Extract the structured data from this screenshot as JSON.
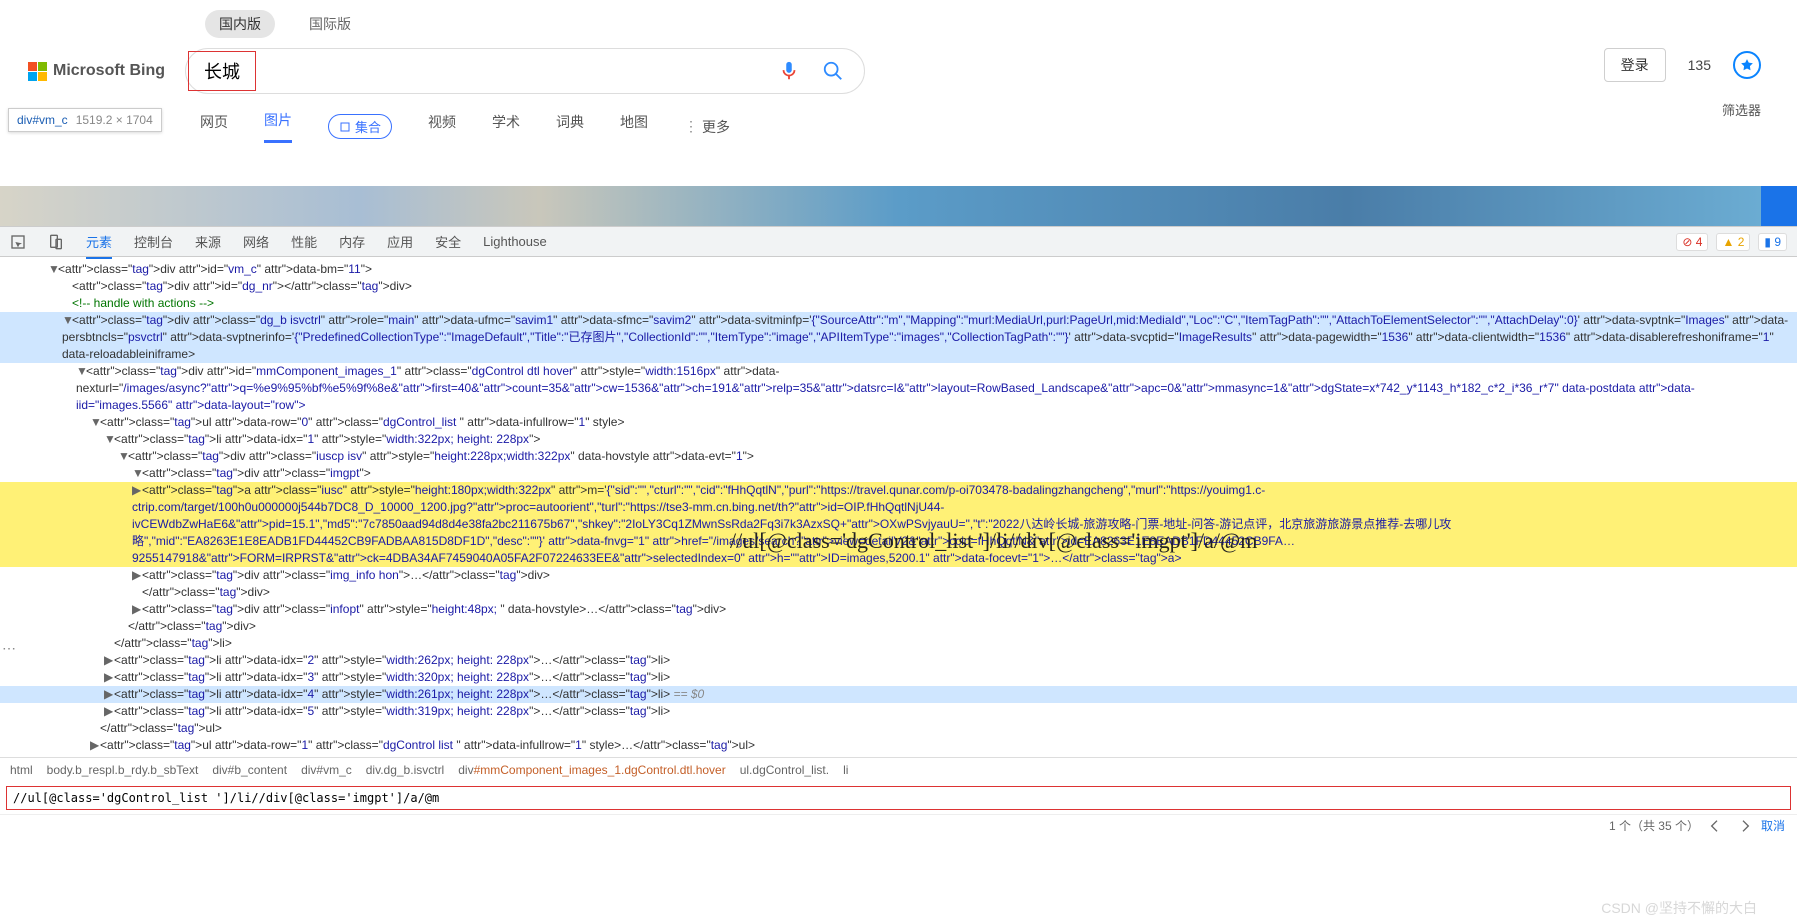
{
  "region_tabs": {
    "domestic": "国内版",
    "intl": "国际版"
  },
  "logo": "Microsoft Bing",
  "search": {
    "value": "长城"
  },
  "top_right": {
    "login": "登录",
    "number": "135"
  },
  "filter_label": "筛选器",
  "nav": {
    "web": "网页",
    "images": "图片",
    "collect": "集合",
    "video": "视频",
    "scholar": "学术",
    "dict": "词典",
    "map": "地图",
    "more": "更多"
  },
  "tooltip": {
    "selector": "div#vm_c",
    "dims": "1519.2 × 1704"
  },
  "dt_tabs": {
    "elements": "元素",
    "console": "控制台",
    "sources": "来源",
    "network": "网络",
    "performance": "性能",
    "memory": "内存",
    "application": "应用",
    "security": "安全",
    "lighthouse": "Lighthouse"
  },
  "dt_badges": {
    "errors": "4",
    "warnings": "2",
    "info": "9"
  },
  "dom": {
    "l1": "<div id=\"vm_c\" data-bm=\"11\">",
    "l2": "<div id=\"dg_nr\"></div>",
    "l3": "<!-- handle with actions -->",
    "l4": "<div class=\"dg_b isvctrl\" role=\"main\" data-ufmc=\"savim1\" data-sfmc=\"savim2\" data-svitminfp='{\"SourceAttr\":\"m\",\"Mapping\":\"murl:MediaUrl,purl:PageUrl,mid:MediaId\",\"Loc\":\"C\",\"ItemTagPath\":\"\",\"AttachToElementSelector\":\"\",\"AttachDelay\":0}' data-svptnk=\"Images\" data-persbtncls=\"psvctrl\" data-svptnerinfo='{\"PredefinedCollectionType\":\"ImageDefault\",\"Title\":\"已存图片\",\"CollectionId\":\"\",\"ItemType\":\"image\",\"APIItemType\":\"images\",\"CollectionTagPath\":\"\"}' data-svcptid=\"ImageResults\" data-pagewidth=\"1536\" data-clientwidth=\"1536\" data-disablerefreshoniframe=\"1\" data-reloadableiniframe>",
    "l5": "<div id=\"mmComponent_images_1\" class=\"dgControl dtl hover\" style=\"width:1516px\" data-nexturl=\"/images/async?q=%e9%95%bf%e5%9f%8e&first=40&count=35&cw=1536&ch=191&relp=35&datsrc=I&layout=RowBased_Landscape&apc=0&mmasync=1&dgState=x*742_y*1143_h*182_c*2_i*36_r*7\" data-postdata data-iid=\"images.5566\" data-layout=\"row\">",
    "l6": "<ul data-row=\"0\" class=\"dgControl_list \" data-infullrow=\"1\" style>",
    "l7": "<li data-idx=\"1\" style=\"width:322px; height: 228px\">",
    "l8": "<div class=\"iuscp isv\" style=\"height:228px;width:322px\" data-hovstyle data-evt=\"1\">",
    "l9": "<div class=\"imgpt\">",
    "l10": "<a class=\"iusc\" style=\"height:180px;width:322px\" m='{\"sid\":\"\",\"cturl\":\"\",\"cid\":\"fHhQqtlN\",\"purl\":\"https://travel.qunar.com/p-oi703478-badalingzhangcheng\",\"murl\":\"https://youimg1.c-ctrip.com/target/100h0u000000j544b7DC8_D_10000_1200.jpg?proc=autoorient\",\"turl\":\"https://tse3-mm.cn.bing.net/th?id=OIP.fHhQqtlNjU44-ivCEWdbZwHaE6&pid=15.1\",\"md5\":\"7c7850aad94d8d4e38fa2bc211675b67\",\"shkey\":\"2IoLY3Cq1ZMwnSsRda2Fq3i7k3AzxSQ+OXwPSvjyauU=\",\"t\":\"2022八达岭长城-旅游攻略-门票-地址-问答-游记点评，北京旅游旅游景点推荐-去哪儿攻略\",\"mid\":\"EA8263E1E8EADB1FD44452CB9FADBAA815D8DF1D\",\"desc\":\"\"}' data-fnvg=\"1\" href=\"/images/search?view=detailV2&ccid=fHhQqtlN&id=EA8263E1E8EADB1FD44452CB9FA…9255147918&FORM=IRPRST&ck=4DBA34AF7459040A05FA2F07224633EE&selectedIndex=0\" h=\"ID=images,5200.1\" data-focevt=\"1\">…</a>",
    "l11": "<div class=\"img_info hon\">…</div>",
    "l12": "</div>",
    "l13": "<div class=\"infopt\" style=\"height:48px; \" data-hovstyle>…</div>",
    "l14": "</div>",
    "l15": "</li>",
    "l16": "<li data-idx=\"2\" style=\"width:262px; height: 228px\">…</li>",
    "l17": "<li data-idx=\"3\" style=\"width:320px; height: 228px\">…</li>",
    "l18": "<li data-idx=\"4\" style=\"width:261px; height: 228px\">…</li>",
    "l18_eq": " == $0",
    "l19": "<li data-idx=\"5\" style=\"width:319px; height: 228px\">…</li>",
    "l20": "</ul>",
    "l21": "<ul data-row=\"1\" class=\"dgControl list \" data-infullrow=\"1\" style>…</ul>"
  },
  "overlay_xpath": "//ul[@class='dgControl_list ']/li//div[@class='imgpt']/a/@m",
  "crumbs": {
    "c1": "html",
    "c2": "body.b_respl.b_rdy.b_sbText",
    "c3": "div#b_content",
    "c4": "div#vm_c",
    "c5": "div.dg_b.isvctrl",
    "c6p": "div",
    "c6s": "#mmComponent_images_1.dgControl.dtl.hover",
    "c7": "ul.dgControl_list.",
    "c8": "li"
  },
  "xpath_input": "//ul[@class='dgControl_list ']/li//div[@class='imgpt']/a/@m",
  "match_count": "1 个（共 35 个）",
  "cancel": "取消",
  "watermark": "CSDN @坚持不懈的大白"
}
